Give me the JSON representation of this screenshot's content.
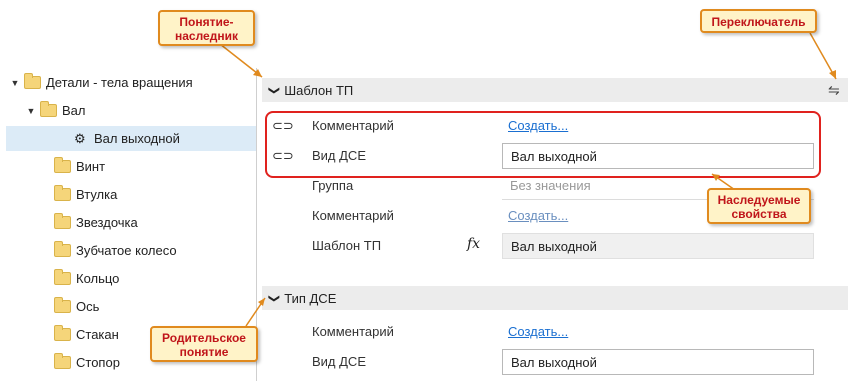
{
  "tree": {
    "items": [
      {
        "label": "Детали - тела вращения",
        "level": 0,
        "expanded": true,
        "icon": "folder-icon"
      },
      {
        "label": "Вал",
        "level": 1,
        "expanded": true,
        "icon": "folder-icon"
      },
      {
        "label": "Вал выходной",
        "level": 2,
        "selected": true,
        "icon": "gear-icon"
      },
      {
        "label": "Винт",
        "level": 1,
        "icon": "folder-icon"
      },
      {
        "label": "Втулка",
        "level": 1,
        "icon": "folder-icon"
      },
      {
        "label": "Звездочка",
        "level": 1,
        "icon": "folder-icon"
      },
      {
        "label": "Зубчатое колесо",
        "level": 1,
        "icon": "folder-icon"
      },
      {
        "label": "Кольцо",
        "level": 1,
        "icon": "folder-icon"
      },
      {
        "label": "Ось",
        "level": 1,
        "icon": "folder-icon"
      },
      {
        "label": "Стакан",
        "level": 1,
        "icon": "folder-icon"
      },
      {
        "label": "Стопор",
        "level": 1,
        "icon": "folder-icon"
      }
    ]
  },
  "panel": {
    "section1": {
      "title": "Шаблон ТП",
      "rows": [
        {
          "label": "Комментарий",
          "link": "Создать...",
          "linked": true
        },
        {
          "label": "Вид ДСЕ",
          "value": "Вал выходной",
          "linked": true
        },
        {
          "label": "Группа",
          "placeholder": "Без значения"
        },
        {
          "label": "Комментарий",
          "link": "Создать..."
        },
        {
          "label": "Шаблон ТП",
          "fx": "fx",
          "value": "Вал выходной"
        }
      ]
    },
    "section2": {
      "title": "Тип ДСЕ",
      "rows": [
        {
          "label": "Комментарий",
          "link": "Создать..."
        },
        {
          "label": "Вид ДСЕ",
          "value": "Вал выходной"
        }
      ]
    }
  },
  "callouts": {
    "child_concept": "Понятие-\nнаследник",
    "switcher": "Переключатель",
    "inherited": "Наследуемые\nсвойства",
    "parent_concept": "Родительское\nпонятие"
  },
  "colors": {
    "accent_link": "#1a6fd1",
    "callout_border": "#e08a1e",
    "callout_text": "#c0151a",
    "highlight": "#e0221e"
  }
}
